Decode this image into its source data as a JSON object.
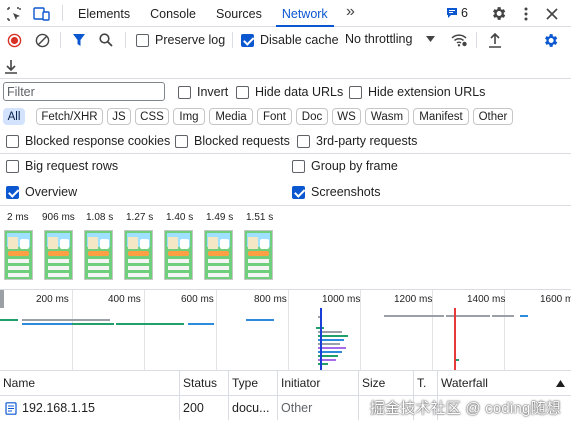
{
  "tabs": [
    "Elements",
    "Console",
    "Sources",
    "Network"
  ],
  "active_tab": "Network",
  "more_tabs_glyph": "»",
  "issues_count": "6",
  "toolbar": {
    "preserve_log": "Preserve log",
    "disable_cache": "Disable cache",
    "throttling": "No throttling"
  },
  "filter": {
    "placeholder": "Filter",
    "invert": "Invert",
    "hide_data_urls": "Hide data URLs",
    "hide_extension_urls": "Hide extension URLs"
  },
  "type_chips": [
    "All",
    "Fetch/XHR",
    "JS",
    "CSS",
    "Img",
    "Media",
    "Font",
    "Doc",
    "WS",
    "Wasm",
    "Manifest",
    "Other"
  ],
  "active_chip": "All",
  "blocking": {
    "blocked_cookies": "Blocked response cookies",
    "blocked_requests": "Blocked requests",
    "third_party": "3rd-party requests"
  },
  "options": {
    "big_rows": "Big request rows",
    "group_by_frame": "Group by frame",
    "overview": "Overview",
    "screenshots": "Screenshots"
  },
  "filmstrip_times": [
    "2 ms",
    "906 ms",
    "1.08 s",
    "1.27 s",
    "1.40 s",
    "1.49 s",
    "1.51 s"
  ],
  "timeline_ticks": [
    "200 ms",
    "400 ms",
    "600 ms",
    "800 ms",
    "1000 ms",
    "1200 ms",
    "1400 ms",
    "1600 ms"
  ],
  "table": {
    "headers": [
      "Name",
      "Status",
      "Type",
      "Initiator",
      "Size",
      "T.",
      "Waterfall"
    ],
    "rows": [
      {
        "name": "192.168.1.15",
        "status": "200",
        "type": "docu...",
        "initiator": "Other"
      }
    ]
  },
  "watermark": "掘金技术社区 @ coding随想",
  "colors": {
    "accent": "#0b57d0",
    "record_red": "#d93025",
    "waterfall_green": "#21a06b",
    "waterfall_blue": "#2e8bdb",
    "waterfall_grey": "#9aa0a6",
    "load_line_red": "#e63a3a",
    "dcl_line_blue": "#1a3fd6"
  }
}
